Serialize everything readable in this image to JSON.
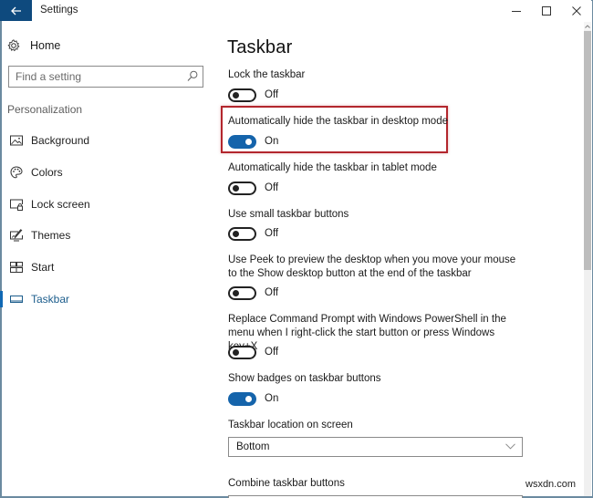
{
  "window": {
    "title": "Settings",
    "back_icon": "arrow-left-icon",
    "controls": {
      "minimize": "minimize-icon",
      "maximize": "maximize-icon",
      "close": "close-icon"
    }
  },
  "sidebar": {
    "home_label": "Home",
    "search_placeholder": "Find a setting",
    "search_value": "",
    "section_label": "Personalization",
    "items": [
      {
        "label": "Background",
        "icon": "picture-icon",
        "active": false
      },
      {
        "label": "Colors",
        "icon": "palette-icon",
        "active": false
      },
      {
        "label": "Lock screen",
        "icon": "lock-screen-icon",
        "active": false
      },
      {
        "label": "Themes",
        "icon": "themes-icon",
        "active": false
      },
      {
        "label": "Start",
        "icon": "start-icon",
        "active": false
      },
      {
        "label": "Taskbar",
        "icon": "taskbar-icon",
        "active": true
      }
    ]
  },
  "main": {
    "title": "Taskbar",
    "settings": [
      {
        "label": "Lock the taskbar",
        "state": "Off",
        "on": false
      },
      {
        "label": "Automatically hide the taskbar in desktop mode",
        "state": "On",
        "on": true,
        "highlighted": true
      },
      {
        "label": "Automatically hide the taskbar in tablet mode",
        "state": "Off",
        "on": false
      },
      {
        "label": "Use small taskbar buttons",
        "state": "Off",
        "on": false
      },
      {
        "label": "Use Peek to preview the desktop when you move your mouse to the Show desktop button at the end of the taskbar",
        "state": "Off",
        "on": false
      },
      {
        "label": "Replace Command Prompt with Windows PowerShell in the menu when I right-click the start button or press Windows key+X",
        "state": "Off",
        "on": false
      },
      {
        "label": "Show badges on taskbar buttons",
        "state": "On",
        "on": true
      }
    ],
    "location": {
      "label": "Taskbar location on screen",
      "value": "Bottom"
    },
    "combine": {
      "label": "Combine taskbar buttons"
    }
  },
  "colors": {
    "accent": "#1564ab",
    "titlebar_back": "#0e4a7e",
    "highlight_border": "#b3262d"
  },
  "watermark": "wsxdn.com"
}
